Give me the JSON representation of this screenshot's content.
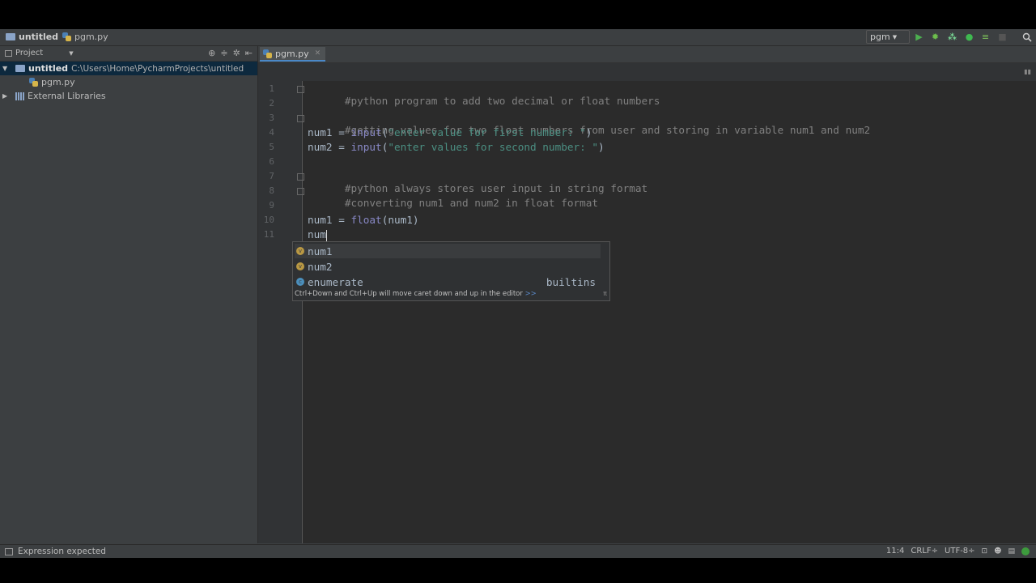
{
  "navbar": {
    "project": "untitled",
    "file": "pgm.py",
    "run_config": "pgm"
  },
  "project_panel": {
    "title": "Project",
    "root": {
      "name": "untitled",
      "path": "C:\\Users\\Home\\PycharmProjects\\untitled"
    },
    "file": "pgm.py",
    "libraries": "External Libraries"
  },
  "editor": {
    "tab": "pgm.py",
    "lines": {
      "l1": "#python program to add two decimal or float numbers",
      "l3": "#getting values for two float numbers from user and storing in variable num1 and num2",
      "l4_var": "num1",
      "l4_op": " = ",
      "l4_fn": "input",
      "l4_str": "\"enter value for first number: \"",
      "l5_var": "num2",
      "l5_op": " = ",
      "l5_fn": "input",
      "l5_str": "\"enter values for second number: \"",
      "l7": "#python always stores user input in string format",
      "l8": "#converting num1 and num2 in float format",
      "l10_var": "num1",
      "l10_op": " = ",
      "l10_fn": "float",
      "l10_arg": "(num1)",
      "l11": "num",
      "paren_open": "(",
      "paren_close": ")"
    },
    "line_numbers": [
      "1",
      "2",
      "3",
      "4",
      "5",
      "6",
      "7",
      "8",
      "9",
      "10",
      "11"
    ]
  },
  "completion": {
    "items": [
      {
        "label": "num1",
        "kind": "v",
        "type": ""
      },
      {
        "label": "num2",
        "kind": "v",
        "type": ""
      },
      {
        "label": "enumerate",
        "kind": "f",
        "type": "builtins"
      }
    ],
    "hint": "Ctrl+Down and Ctrl+Up will move caret down and up in the editor",
    "hint_link": ">>",
    "pi": "π"
  },
  "status": {
    "message": "Expression expected",
    "position": "11:4",
    "line_sep": "CRLF÷",
    "encoding": "UTF-8÷"
  }
}
